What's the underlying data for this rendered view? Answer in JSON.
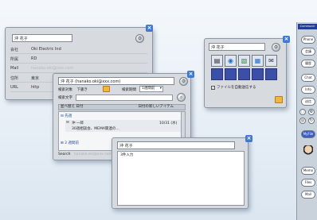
{
  "contact_card": {
    "title": "沖 花子",
    "rows": [
      {
        "label": "会社",
        "value": "Oki Electric Ind"
      },
      {
        "label": "所属",
        "value": "RD"
      },
      {
        "label": "Mail",
        "value": "hanako.oki@xxx.com"
      },
      {
        "label": "住所",
        "value": "東京"
      },
      {
        "label": "URL",
        "value": "http"
      }
    ]
  },
  "mail_window": {
    "title": "沖 花子 (hanako.oki@xxx.com)",
    "search_target_label": "検索対象",
    "search_target_value": "下書き",
    "period_label": "検索期間",
    "period_value": "1週間前",
    "search_text_label": "検索文字",
    "columns": {
      "sort": "並べ替え 日付",
      "date": "日付の新しいアイテム"
    },
    "group1": "先週",
    "message": {
      "sender": "沖 一郎",
      "date": "10/31 (水)",
      "subject": "30週相談会、MEMA関連の…"
    },
    "group2": "2 週間前",
    "footer_label": "Search",
    "footer_value": "hanako.oki@xxx.com"
  },
  "compose_window": {
    "title": "沖 花子",
    "body": "3件入力"
  },
  "icon_window": {
    "title": "沖 花子",
    "checkbox_label": "ファイルを自動送信する",
    "checkbox_checked": true,
    "tile_icons": [
      "document-icon",
      "globe-icon",
      "image-icon",
      "photo-icon",
      "mail-icon"
    ]
  },
  "sidebar": {
    "logo": "Communic",
    "buttons": [
      "Phone",
      "会議",
      "履歴",
      "Chat",
      "Info",
      "送信"
    ],
    "primary_button": "MyFile",
    "lower_buttons": [
      "Memo",
      "Files",
      "Mail"
    ]
  }
}
